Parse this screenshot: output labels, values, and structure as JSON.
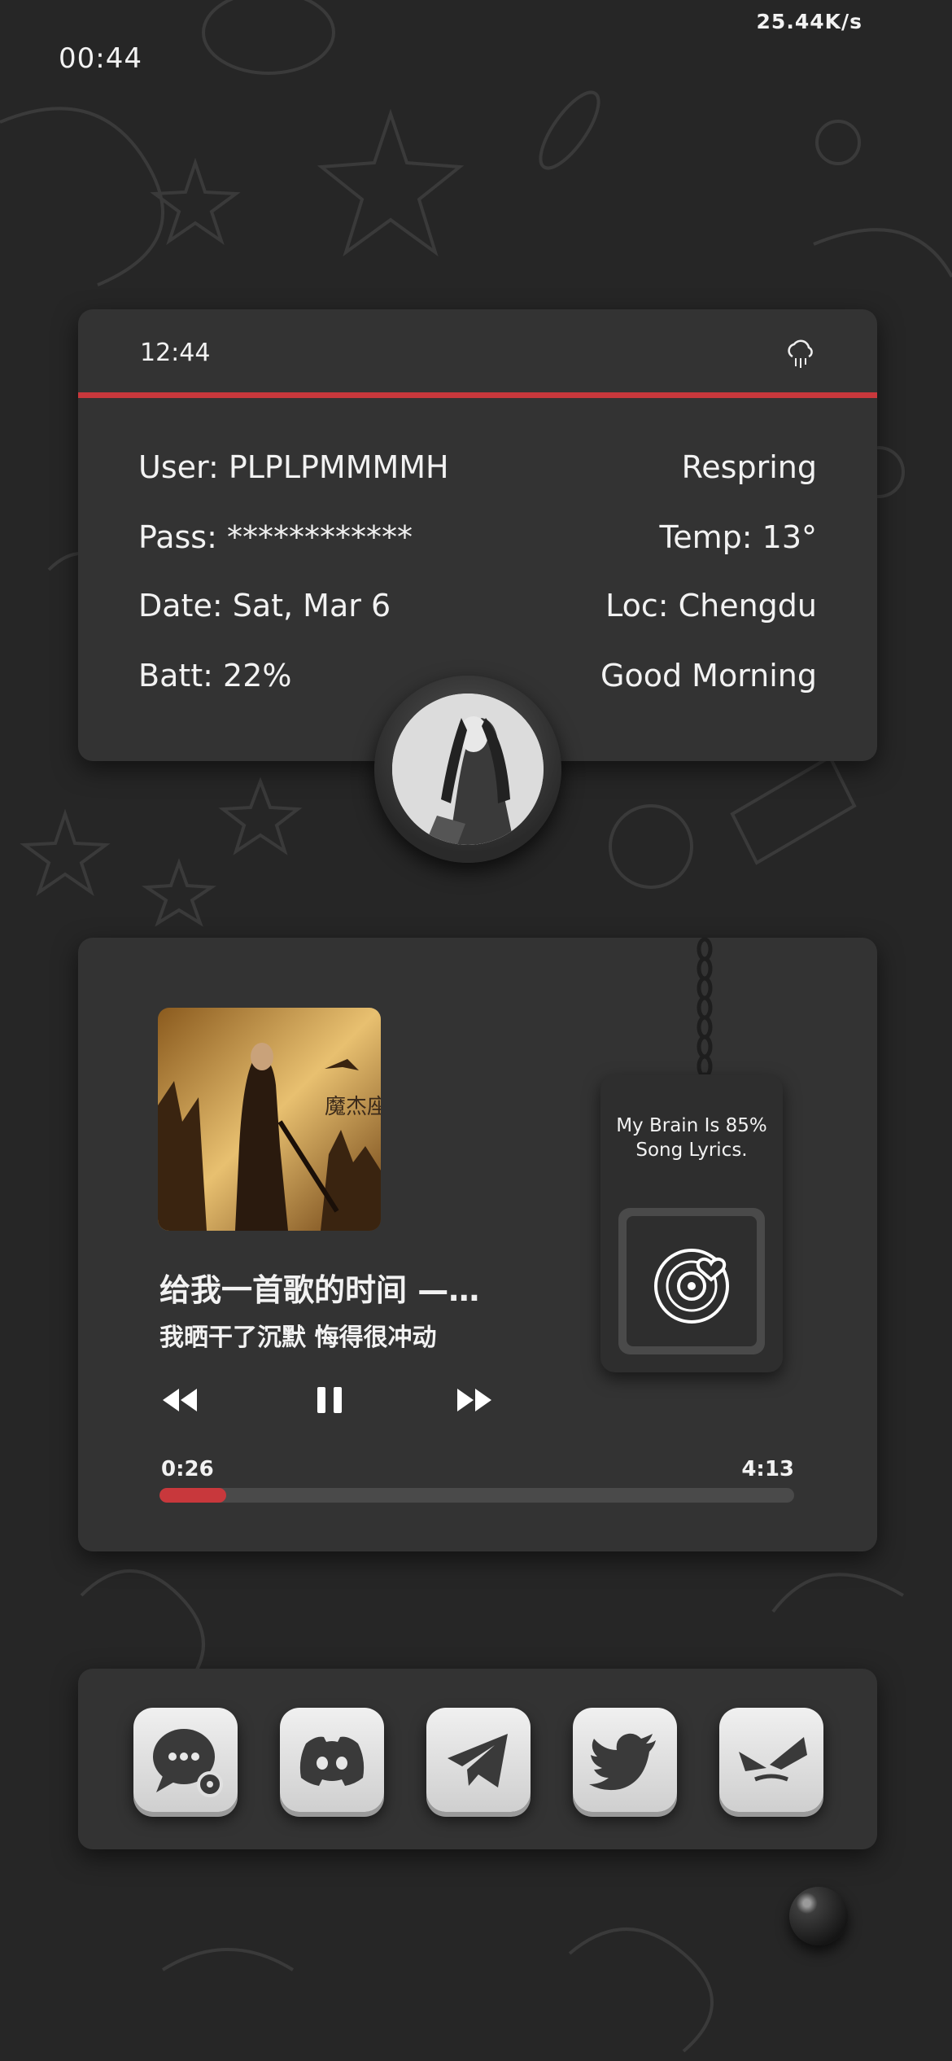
{
  "status_bar": {
    "net_speed": "25.44K/s",
    "time": "00:44"
  },
  "info_widget": {
    "header_time": "12:44",
    "weather_icon": "cloud-rain-icon",
    "left": [
      "User: PLPLPMMMMH",
      "Pass: ************",
      "Date: Sat, Mar 6",
      "Batt: 22%"
    ],
    "right": [
      "Respring",
      "Temp: 13°",
      "Loc: Chengdu",
      "Good Morning"
    ],
    "accent_color": "#c8383c"
  },
  "music_widget": {
    "title": "给我一首歌的时间 —…",
    "lyric": "我晒干了沉默 悔得很冲动",
    "album_cover_text": "魔杰座",
    "current_time": "0:26",
    "total_time": "4:13",
    "progress": 0.105,
    "tag_text": "My Brain Is 85% Song Lyrics.",
    "controls": [
      "rewind-icon",
      "pause-icon",
      "fast-forward-icon"
    ]
  },
  "dock": {
    "apps": [
      "messages-icon",
      "discord-icon",
      "telegram-icon",
      "twitter-icon",
      "shadow-app-icon"
    ]
  }
}
